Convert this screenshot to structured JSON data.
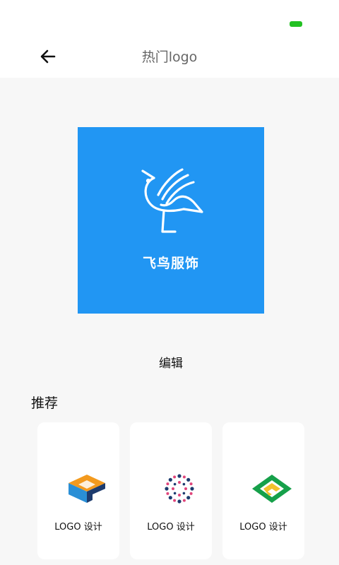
{
  "colors": {
    "accent_blue": "#2196F3",
    "battery_green": "#22C122",
    "logo_orange": "#F39A1E",
    "logo_cyan": "#2A8FD6",
    "logo_navy": "#1D3B6E",
    "logo_pink": "#E0457B",
    "logo_green": "#16A04A",
    "logo_yellow": "#F2C12E"
  },
  "status_bar": {
    "battery_icon": "battery-icon"
  },
  "header": {
    "back_icon": "arrow-left-icon",
    "title": "热门logo"
  },
  "preview": {
    "brand_name": "飞鸟服饰",
    "icon": "bird-icon"
  },
  "edit_label": "编辑",
  "recommend": {
    "title": "推荐",
    "cards": [
      {
        "label": "LOGO 设计",
        "icon": "cube-c-logo-icon"
      },
      {
        "label": "LOGO 设计",
        "icon": "mandala-logo-icon"
      },
      {
        "label": "LOGO 设计",
        "icon": "diamond-logo-icon"
      }
    ]
  }
}
